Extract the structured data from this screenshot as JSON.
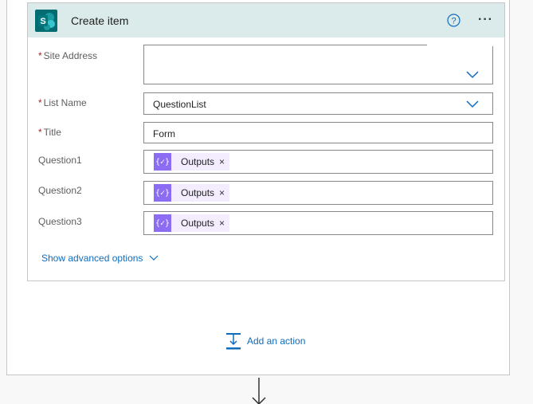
{
  "card": {
    "title": "Create item",
    "help_icon": "help-circle-icon",
    "more_label": "···"
  },
  "fields": {
    "site_address": {
      "label": "Site Address",
      "required": "*",
      "value": ""
    },
    "list_name": {
      "label": "List Name",
      "required": "*",
      "value": "QuestionList"
    },
    "title": {
      "label": "Title",
      "required": "*",
      "value": "Form"
    },
    "question1": {
      "label": "Question1",
      "token": "Outputs"
    },
    "question2": {
      "label": "Question2",
      "token": "Outputs"
    },
    "question3": {
      "label": "Question3",
      "token": "Outputs"
    }
  },
  "token_remove": "×",
  "token_icon_glyph": "{✓}",
  "advanced": {
    "label": "Show advanced options"
  },
  "add_action": {
    "label": "Add an action"
  },
  "colors": {
    "header_bg": "#dbeaea",
    "accent": "#0f6cbd",
    "token_icon": "#8c6cf2",
    "token_bg": "#f4edff",
    "required": "#a4262c"
  }
}
